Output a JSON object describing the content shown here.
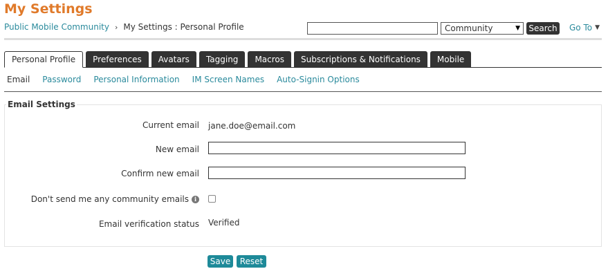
{
  "page": {
    "title": "My Settings"
  },
  "breadcrumb": {
    "community": "Public Mobile Community",
    "separator": "›",
    "current": "My Settings : Personal Profile"
  },
  "search": {
    "value": "",
    "scope": "Community",
    "button": "Search",
    "goto": "Go To"
  },
  "tabs": [
    {
      "label": "Personal Profile",
      "active": true
    },
    {
      "label": "Preferences"
    },
    {
      "label": "Avatars"
    },
    {
      "label": "Tagging"
    },
    {
      "label": "Macros"
    },
    {
      "label": "Subscriptions & Notifications"
    },
    {
      "label": "Mobile"
    }
  ],
  "subtabs": [
    {
      "label": "Email",
      "active": true
    },
    {
      "label": "Password"
    },
    {
      "label": "Personal Information"
    },
    {
      "label": "IM Screen Names"
    },
    {
      "label": "Auto-Signin Options"
    }
  ],
  "form": {
    "legend": "Email Settings",
    "current_email_label": "Current email",
    "current_email_value": "jane.doe@email.com",
    "new_email_label": "New email",
    "new_email_value": "",
    "confirm_email_label": "Confirm new email",
    "confirm_email_value": "",
    "no_emails_label": "Don't send me any community emails",
    "no_emails_checked": false,
    "verification_label": "Email verification status",
    "verification_value": "Verified",
    "save": "Save",
    "reset": "Reset"
  },
  "colors": {
    "title": "#e07a2a",
    "link": "#2a8a9c",
    "button": "#1e8a99",
    "dark": "#333333"
  }
}
